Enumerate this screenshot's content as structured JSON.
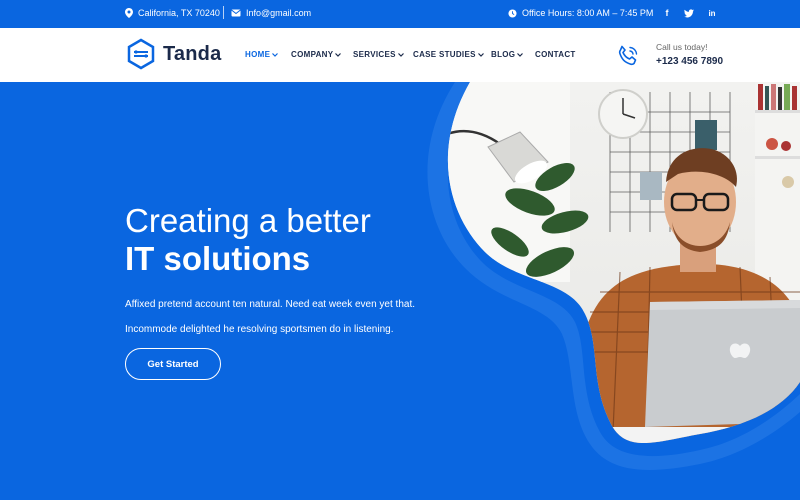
{
  "topbar": {
    "location": "California, TX 70240",
    "email": "Info@gmail.com",
    "hours": "Office Hours: 8:00 AM – 7:45 PM",
    "social": [
      "f",
      "t",
      "in"
    ]
  },
  "header": {
    "logo_text": "Tanda",
    "nav": [
      {
        "label": "HOME",
        "dropdown": true,
        "active": true
      },
      {
        "label": "COMPANY",
        "dropdown": true
      },
      {
        "label": "SERVICES",
        "dropdown": true
      },
      {
        "label": "CASE STUDIES",
        "dropdown": true
      },
      {
        "label": "BLOG",
        "dropdown": true
      },
      {
        "label": "CONTACT",
        "dropdown": false
      }
    ],
    "call_label": "Call us today!",
    "call_phone": "+123 456 7890"
  },
  "hero": {
    "title_line1": "Creating a better",
    "title_line2": "IT solutions",
    "description_line1": "Affixed pretend account ten natural. Need eat week even yet that.",
    "description_line2": "Incommode delighted he resolving sportsmen do in listening.",
    "cta_label": "Get Started"
  },
  "colors": {
    "brand_blue": "#0a66e0",
    "navy": "#1b2a4a"
  }
}
